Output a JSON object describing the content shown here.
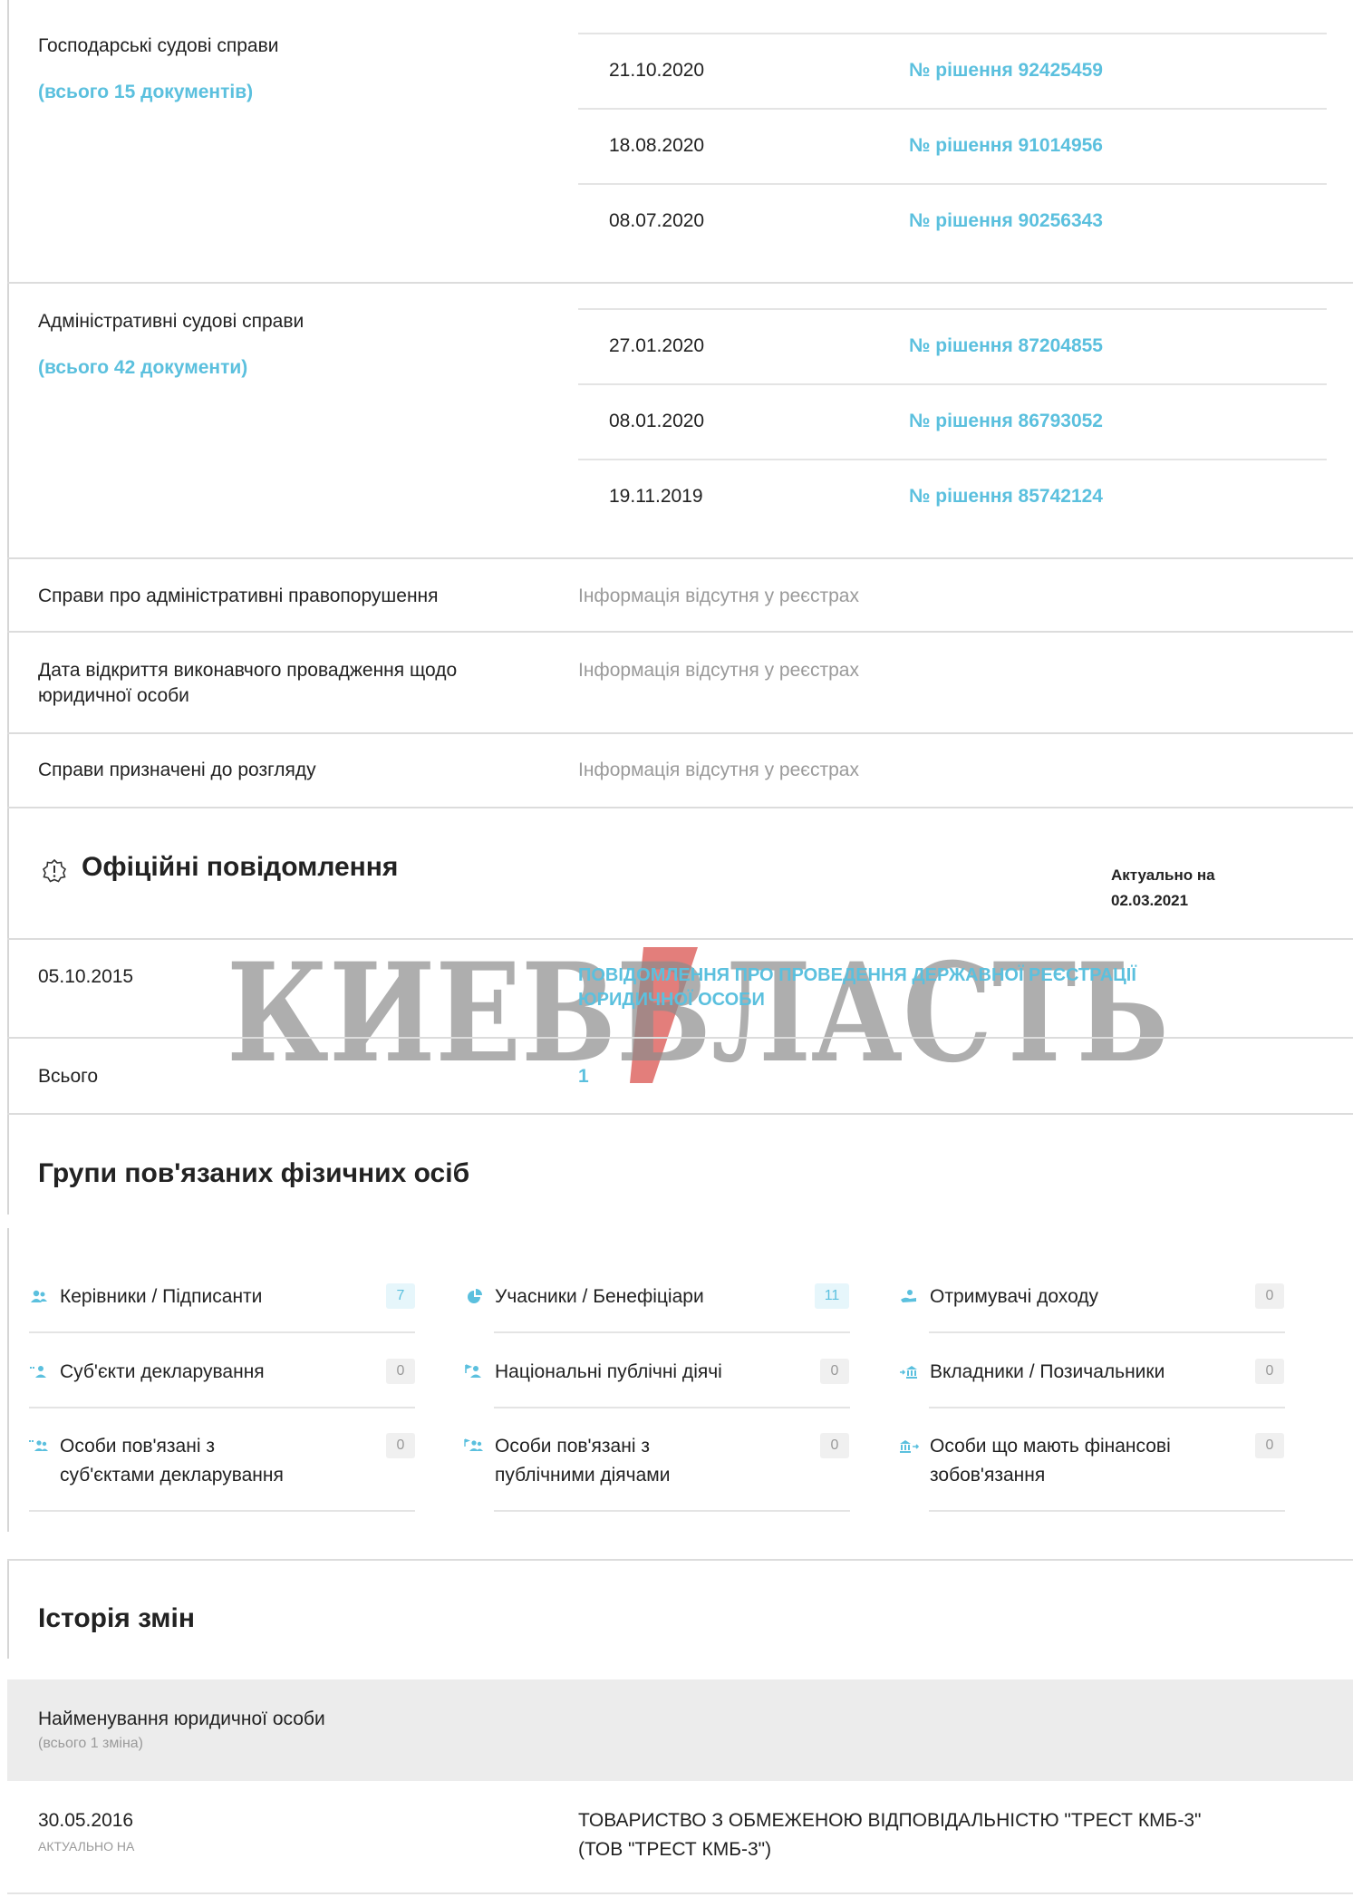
{
  "court": {
    "commercial": {
      "label": "Господарські судові справи",
      "count_link": "(всього 15 документів)",
      "rows": [
        {
          "date": "21.10.2020",
          "decision": "№ рішення 92425459"
        },
        {
          "date": "18.08.2020",
          "decision": "№ рішення 91014956"
        },
        {
          "date": "08.07.2020",
          "decision": "№ рішення 90256343"
        }
      ]
    },
    "administrative": {
      "label": "Адміністративні судові справи",
      "count_link": "(всього 42 документи)",
      "rows": [
        {
          "date": "27.01.2020",
          "decision": "№ рішення 87204855"
        },
        {
          "date": "08.01.2020",
          "decision": "№ рішення 86793052"
        },
        {
          "date": "19.11.2019",
          "decision": "№ рішення 85742124"
        }
      ]
    },
    "offenses": {
      "label": "Справи про адміністративні правопорушення",
      "value": "Інформація відсутня у реєстрах"
    },
    "enforcement": {
      "label_line1": "Дата відкриття виконавчого провадження щодо",
      "label_line2": "юридичної особи",
      "value": "Інформація відсутня у реєстрах"
    },
    "scheduled": {
      "label": "Справи призначені до розгляду",
      "value": "Інформація відсутня у реєстрах"
    }
  },
  "notices": {
    "title": "Офіційні повідомлення",
    "actual_line1": "Актуально на",
    "actual_line2": "02.03.2021",
    "row_date": "05.10.2015",
    "row_link_line1": "ПОВІДОМЛЕННЯ ПРО ПРОВЕДЕННЯ ДЕРЖАВНОЇ РЕЄСТРАЦІЇ",
    "row_link_line2": "ЮРИДИЧНОЇ ОСОБИ",
    "total_label": "Всього",
    "total_value": "1"
  },
  "watermark": {
    "text": "КИЕВВЛАСТЬ"
  },
  "groups": {
    "title": "Групи пов'язаних фізичних осіб",
    "items": [
      {
        "label": "Керівники / Підписанти",
        "count": "7",
        "icon": "users-icon"
      },
      {
        "label": "Учасники / Бенефіціари",
        "count": "11",
        "icon": "pie-chart-icon"
      },
      {
        "label": "Отримувачі доходу",
        "count": "0",
        "icon": "income-icon"
      },
      {
        "label": "Суб'єкти декларування",
        "count": "0",
        "icon": "declarant-icon"
      },
      {
        "label": "Національні публічні діячі",
        "count": "0",
        "icon": "flag-person-icon"
      },
      {
        "label": "Вкладники / Позичальники",
        "count": "0",
        "icon": "bank-in-icon"
      },
      {
        "label_line1": "Особи пов'язані з",
        "label_line2": "суб'єктами декларування",
        "count": "0",
        "icon": "declarant-group-icon"
      },
      {
        "label_line1": "Особи пов'язані з",
        "label_line2": "публічними діячами",
        "count": "0",
        "icon": "flag-group-icon"
      },
      {
        "label_line1": "Особи що мають фінансові",
        "label_line2": "зобов'язання",
        "count": "0",
        "icon": "bank-out-icon"
      }
    ]
  },
  "history": {
    "title": "Історія змін",
    "section_label": "Найменування юридичної особи",
    "section_sub": "(всього 1 зміна)",
    "row_date": "30.05.2016",
    "row_date_sub": "АКТУАЛЬНО НА",
    "row_value_line1": "ТОВАРИСТВО З ОБМЕЖЕНОЮ ВІДПОВІДАЛЬНІСТЮ \"ТРЕСТ КМБ-3\"",
    "row_value_line2": "(ТОВ \"ТРЕСТ КМБ-3\")"
  },
  "colors": {
    "accent": "#5bc0de",
    "muted": "#9a9a9a",
    "band": "#ececec"
  }
}
